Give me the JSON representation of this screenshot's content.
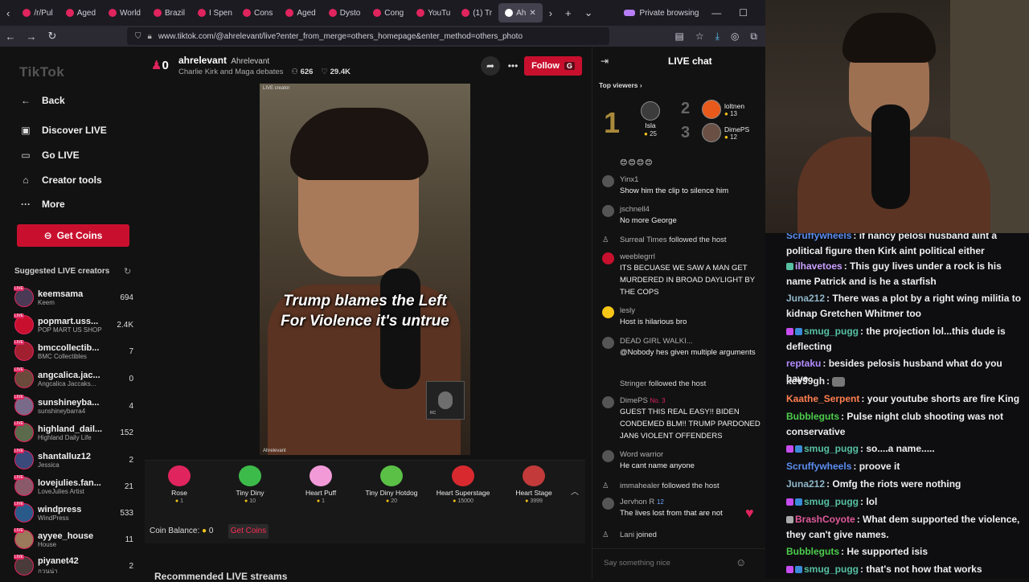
{
  "browser": {
    "tabs": [
      {
        "label": "/r/Pul"
      },
      {
        "label": "Aged"
      },
      {
        "label": "World"
      },
      {
        "label": "Brazil"
      },
      {
        "label": "I Spen"
      },
      {
        "label": "Cons"
      },
      {
        "label": "Aged"
      },
      {
        "label": "Dysto"
      },
      {
        "label": "Cong"
      },
      {
        "label": "YouTu"
      },
      {
        "label": "(1) Tr"
      },
      {
        "label": "Ah"
      }
    ],
    "private_label": "Private browsing",
    "url": "www.tiktok.com/@ahrelevant/live?enter_from_merge=others_homepage&enter_method=others_photo"
  },
  "sidebar": {
    "logo": "TikTok",
    "nav": [
      {
        "label": "Back",
        "icon": "←"
      },
      {
        "label": "Discover LIVE",
        "icon": "▣"
      },
      {
        "label": "Go LIVE",
        "icon": "▭"
      },
      {
        "label": "Creator tools",
        "icon": "⌂"
      },
      {
        "label": "More",
        "icon": "···"
      }
    ],
    "get_coins": "Get Coins",
    "suggested_title": "Suggested LIVE creators",
    "creators": [
      {
        "name": "keemsama",
        "sub": "Keem",
        "count": "694"
      },
      {
        "name": "popmart.uss...",
        "sub": "POP MART US SHOP",
        "count": "2.4K"
      },
      {
        "name": "bmccollectib...",
        "sub": "BMC Collectibles",
        "count": "7"
      },
      {
        "name": "angcalica.jac...",
        "sub": "Angcalica Jaccaks...",
        "count": "0"
      },
      {
        "name": "sunshineyba...",
        "sub": "sunshineybarra4",
        "count": "4"
      },
      {
        "name": "highland_dail...",
        "sub": "Highland Daily Life",
        "count": "152"
      },
      {
        "name": "shantalluz12",
        "sub": "Jessica",
        "count": "2"
      },
      {
        "name": "lovejulies.fan...",
        "sub": "LoveJulies Artist",
        "count": "21"
      },
      {
        "name": "windpress",
        "sub": "WindPress",
        "count": "533"
      },
      {
        "name": "ayyee_house",
        "sub": "House",
        "count": "11"
      },
      {
        "name": "piyanet42",
        "sub": "กวนน่า",
        "count": "2"
      }
    ]
  },
  "stream": {
    "rank_count": "0",
    "host_name": "ahrelevant",
    "host_display": "Ahrelevant",
    "title": "Charlie Kirk and Maga debates",
    "viewers": "626",
    "likes": "29.4K",
    "follow_label": "Follow",
    "follow_key": "G",
    "caption_line1": "Trump blames the Left",
    "caption_line2": "For Violence it's untrue",
    "video_label": "LIVE creator",
    "video_credit": "Ahrelevant",
    "pip_label": "RC"
  },
  "gifts": {
    "items": [
      {
        "name": "Rose",
        "price": "1",
        "color": "#e0245e"
      },
      {
        "name": "Tiny Diny",
        "price": "10",
        "color": "#3dbb4a"
      },
      {
        "name": "Heart Puff",
        "price": "1",
        "color": "#f29ad8"
      },
      {
        "name": "Tiny Diny Hotdog",
        "price": "20",
        "color": "#5ac146"
      },
      {
        "name": "Heart Superstage",
        "price": "15000",
        "color": "#d8292f"
      },
      {
        "name": "Heart Stage",
        "price": "3999",
        "color": "#c23a3a"
      }
    ],
    "balance_label": "Coin Balance:",
    "balance_value": "0",
    "get_coins": "Get Coins",
    "recommended": "Recommended LIVE streams"
  },
  "live_chat": {
    "title": "LIVE chat",
    "top_viewers_label": "Top viewers",
    "top_viewers": [
      {
        "rank": "1",
        "name": "Isla",
        "score": "25"
      },
      {
        "rank": "2",
        "name": "loltnen",
        "score": "13"
      },
      {
        "rank": "3",
        "name": "DimePS",
        "score": "12"
      }
    ],
    "emoji_row": "😊😊😊😊",
    "messages": [
      {
        "user": "Yinx1",
        "text": "Show him the clip to silence him"
      },
      {
        "user": "jschnell4",
        "text": "No more George"
      },
      {
        "user": "weeblegrrl",
        "text": "ITS BECUASE WE SAW A MAN GET MURDERED IN BROAD DAYLIGHT BY THE COPS"
      },
      {
        "user": "lesly",
        "text": "Host is hilarious bro"
      },
      {
        "user": "DEAD GIRL WALKI...",
        "text": "@Nobody hes given multiple arguments"
      },
      {
        "user": "DimePS",
        "badge": "No. 3",
        "text": "GUEST THIS REAL EASY!! BIDEN CONDEMED BLM!! TRUMP PARDONED JAN6 VIOLENT OFFENDERS"
      },
      {
        "user": "Word warrior",
        "text": "He cant name anyone"
      },
      {
        "user": "Jervhon R",
        "badge": "12",
        "text": "The lives lost from that are not"
      }
    ],
    "system": [
      {
        "user": "Surreal Times",
        "text": "followed the host"
      },
      {
        "user": "Stringer",
        "text": "followed the host"
      },
      {
        "user": "immahealer",
        "text": "followed the host"
      },
      {
        "user": "Lani",
        "text": "joined"
      }
    ],
    "input_placeholder": "Say something nice"
  },
  "twitch_chat": {
    "messages": [
      {
        "user": "Scruffywheels",
        "color": "#5b8def",
        "text": ": if nancy pelosi husband aint a political figure then Kirk aint political either"
      },
      {
        "user": "ilhavetoes",
        "color": "#c9a0ff",
        "text": ": This guy lives under a rock is his name Patrick and is he a starfish"
      },
      {
        "user": "Juna212",
        "color": "#8fb6c9",
        "text": ": There was a plot by a right wing militia to kidnap Gretchen Whitmer too"
      },
      {
        "user": "smug_pugg",
        "color": "#56c0a0",
        "text": ": the projection lol...this dude is deflecting"
      },
      {
        "user": "reptaku",
        "color": "#b48bff",
        "text": ": besides pelosis husband what do you have"
      },
      {
        "user": "kev99gh",
        "color": "#e8e8e8",
        "text": ":"
      },
      {
        "user": "Kaathe_Serpent",
        "color": "#ff7f50",
        "text": ": your youtube shorts are fire King"
      },
      {
        "user": "Bubbleguts",
        "color": "#4ccd4c",
        "text": ": Pulse night club shooting was not conservative"
      },
      {
        "user": "smug_pugg",
        "color": "#56c0a0",
        "text": ": so....a name....."
      },
      {
        "user": "Scruffywheels",
        "color": "#5b8def",
        "text": ": proove it"
      },
      {
        "user": "Juna212",
        "color": "#8fb6c9",
        "text": ": Omfg the riots were nothing"
      },
      {
        "user": "smug_pugg",
        "color": "#56c0a0",
        "text": ": lol"
      },
      {
        "user": "BrashCoyote",
        "color": "#e05a9a",
        "text": ": What dem supported the violence, they can't give names."
      },
      {
        "user": "Bubbleguts",
        "color": "#4ccd4c",
        "text": ": He supported isis"
      },
      {
        "user": "smug_pugg",
        "color": "#56c0a0",
        "text": ": that's not how that works"
      }
    ]
  }
}
